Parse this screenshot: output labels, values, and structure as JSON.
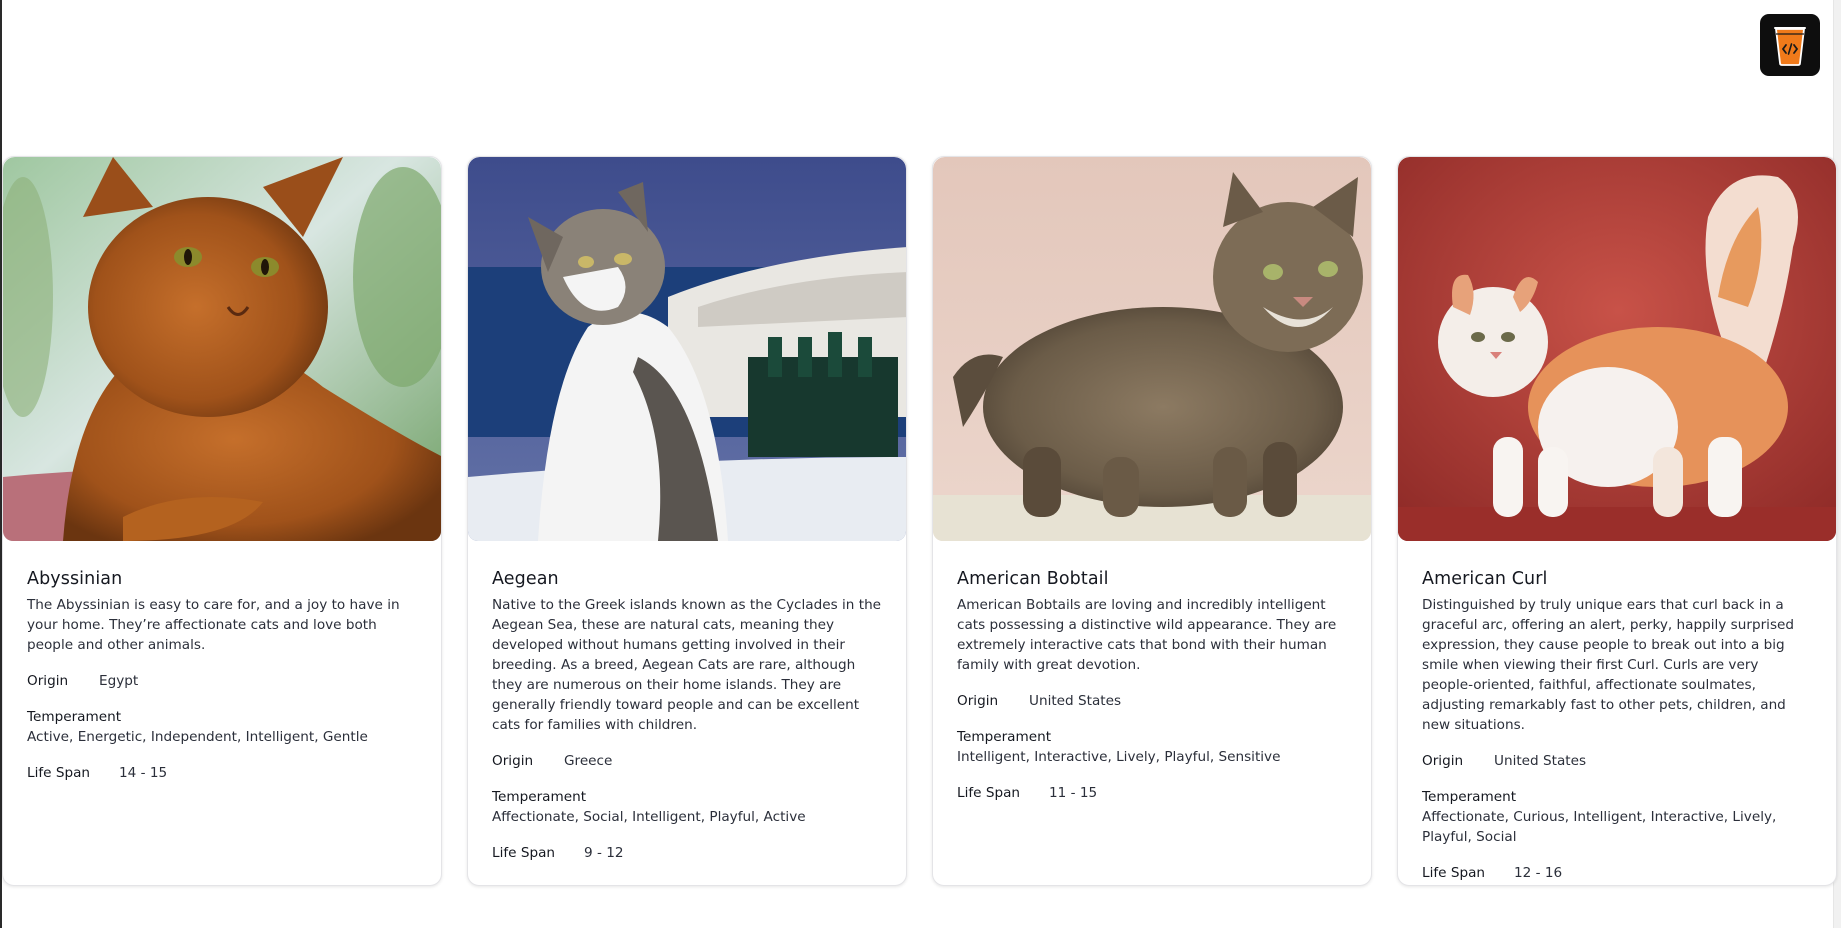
{
  "app": {
    "logo_icon": "orange-cup-code-icon"
  },
  "labels": {
    "origin": "Origin",
    "temperament": "Temperament",
    "life_span": "Life Span"
  },
  "breeds": [
    {
      "name": "Abyssinian",
      "description": "The Abyssinian is easy to care for, and a joy to have in your home. They’re affectionate cats and love both people and other animals.",
      "origin": "Egypt",
      "temperament": "Active, Energetic, Independent, Intelligent, Gentle",
      "life_span": "14 - 15",
      "photo": "ruddy-cat-lying-photo"
    },
    {
      "name": "Aegean",
      "description": "Native to the Greek islands known as the Cyclades in the Aegean Sea, these are natural cats, meaning they developed without humans getting involved in their breeding. As a breed, Aegean Cats are rare, although they are numerous on their home islands. They are generally friendly toward people and can be excellent cats for families with children.",
      "origin": "Greece",
      "temperament": "Affectionate, Social, Intelligent, Playful, Active",
      "life_span": "9 - 12",
      "photo": "tabby-white-cat-island-photo"
    },
    {
      "name": "American Bobtail",
      "description": "American Bobtails are loving and incredibly intelligent cats possessing a distinctive wild appearance. They are extremely interactive cats that bond with their human family with great devotion.",
      "origin": "United States",
      "temperament": "Intelligent, Interactive, Lively, Playful, Sensitive",
      "life_span": "11 - 15",
      "photo": "tabby-bobtail-standing-photo"
    },
    {
      "name": "American Curl",
      "description": "Distinguished by truly unique ears that curl back in a graceful arc, offering an alert, perky, happily surprised expression, they cause people to break out into a big smile when viewing their first Curl. Curls are very people-oriented, faithful, affectionate soulmates, adjusting remarkably fast to other pets, children, and new situations.",
      "origin": "United States",
      "temperament": "Affectionate, Curious, Intelligent, Interactive, Lively, Playful, Social",
      "life_span": "12 - 16",
      "photo": "orange-white-curl-cat-photo"
    }
  ]
}
